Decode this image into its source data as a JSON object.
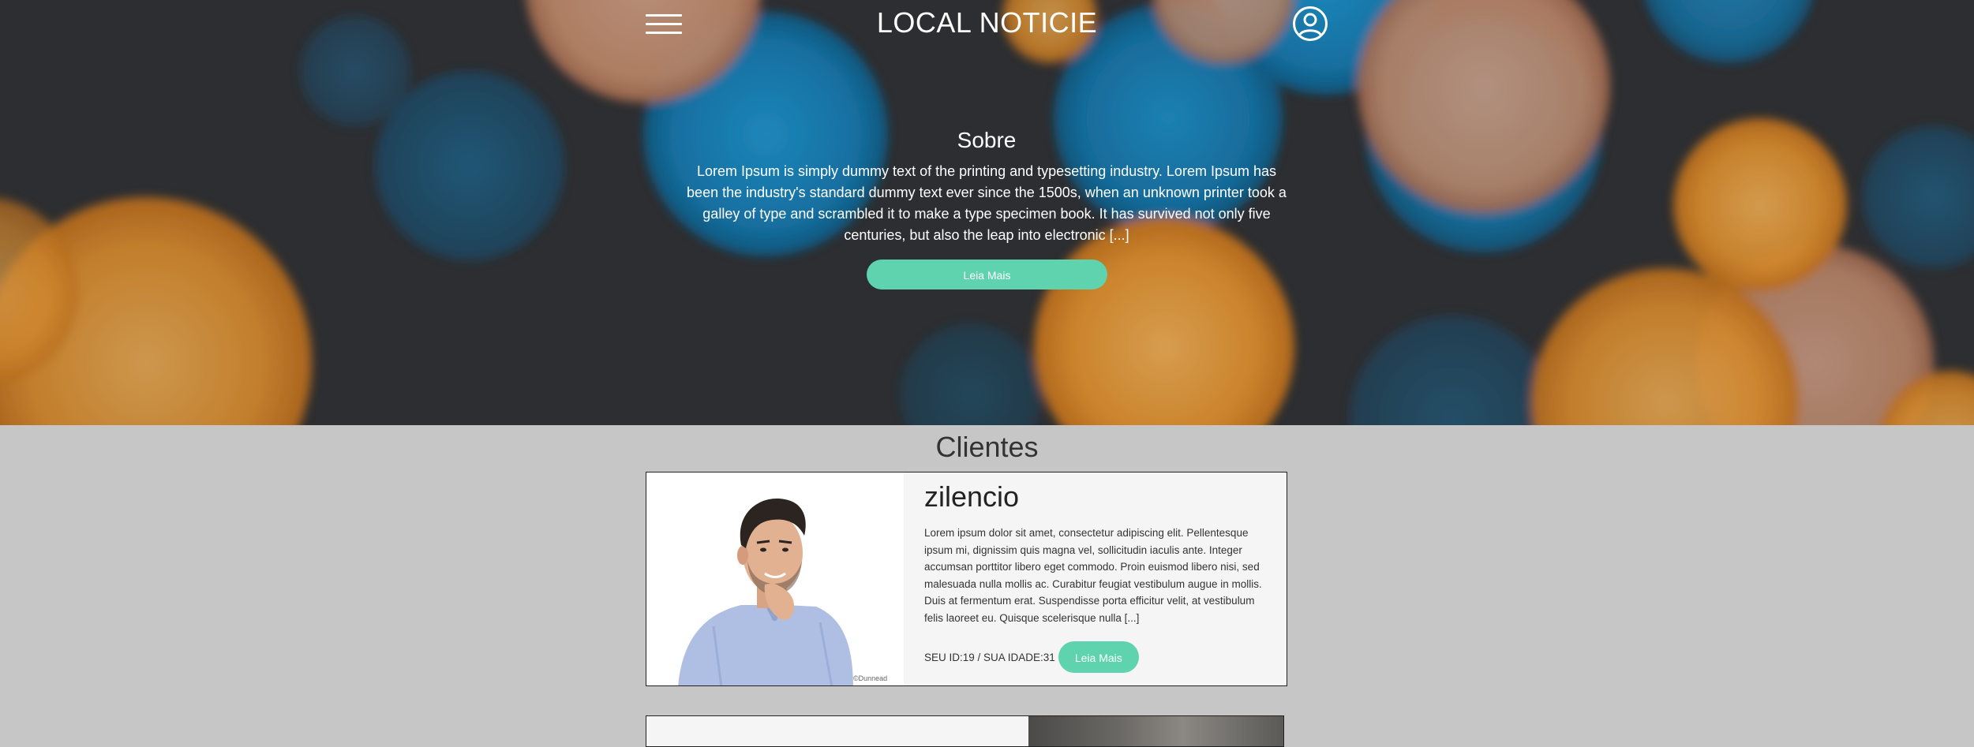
{
  "header": {
    "title": "LOCAL NOTICIE",
    "menu_icon": "hamburger-menu-icon",
    "user_icon": "user-circle-icon"
  },
  "about": {
    "title": "Sobre",
    "text": "Lorem Ipsum is simply dummy text of the printing and typesetting industry. Lorem Ipsum has been the industry's standard dummy text ever since the 1500s, when an unknown printer took a galley of type and scrambled it to make a type specimen book. It has survived not only five centuries, but also the leap into electronic [...]",
    "button_label": "Leia Mais"
  },
  "clients": {
    "title": "Clientes",
    "items": [
      {
        "name": "zilencio",
        "text": "Lorem ipsum dolor sit amet, consectetur adipiscing elit. Pellentesque ipsum mi, dignissim quis magna vel, sollicitudin iaculis ante. Integer accumsan porttitor libero eget commodo. Proin euismod libero nisi, sed malesuada nulla mollis ac. Curabitur feugiat vestibulum augue in mollis. Duis at fermentum erat. Suspendisse porta efficitur velit, at vestibulum felis laoreet eu. Quisque scelerisque nulla [...]",
        "meta": "SEU ID:19 / SUA IDADE:31",
        "button_label": "Leia Mais",
        "photo_watermark": "©Dunnead"
      }
    ]
  },
  "colors": {
    "accent": "#5fd2ae",
    "page_bg": "#c6c6c6",
    "hero_bg": "#2e2f33",
    "bokeh_orange": "#f0a23a",
    "bokeh_blue": "#1a8ccc"
  }
}
